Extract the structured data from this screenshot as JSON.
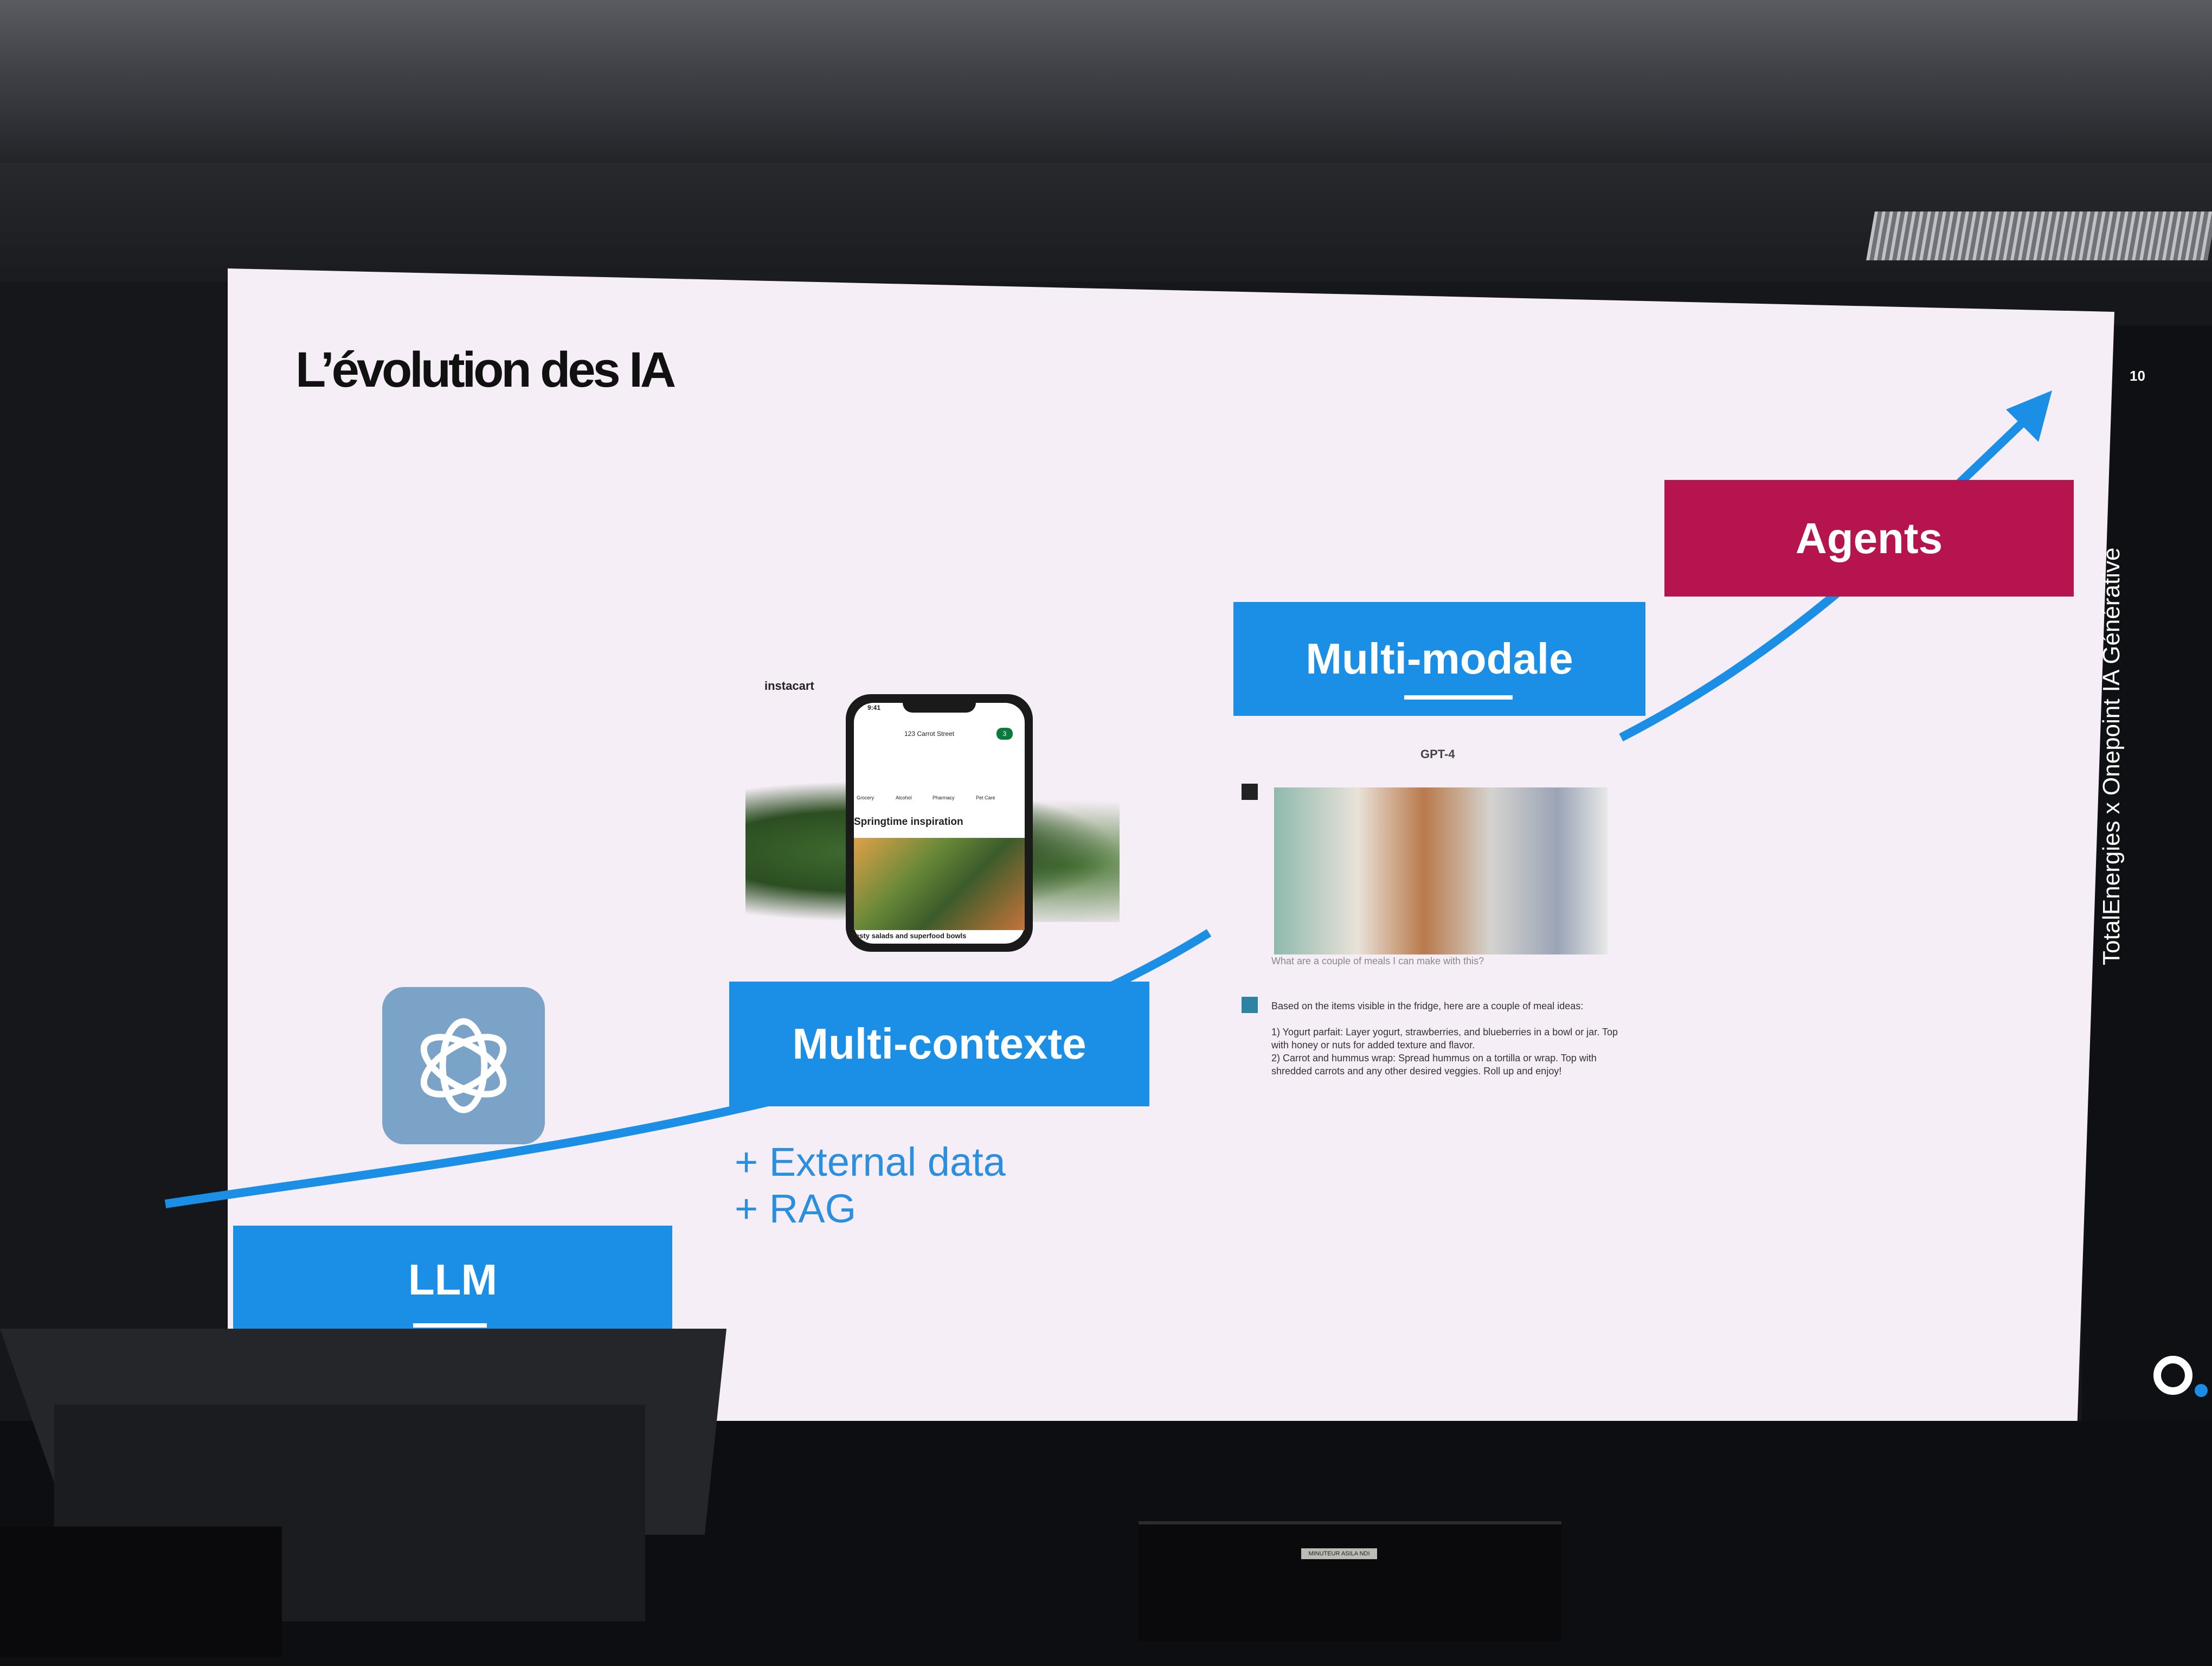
{
  "slide": {
    "title": "L’évolution des IA",
    "page_number": "10",
    "sidebar_text": "TotalEnergies x Onepoint  IA Générative",
    "stages": {
      "llm": "LLM",
      "multi_contexte": "Multi-contexte",
      "multi_modale": "Multi-modale",
      "agents": "Agents"
    },
    "multi_contexte_extras": [
      "+ External data",
      "+ RAG"
    ],
    "colors": {
      "blue": "#1b8fe6",
      "agents": "#b6144f",
      "background": "#f6eef6"
    }
  },
  "instacart": {
    "brand": "instacart",
    "time": "9:41",
    "address": "123 Carrot Street",
    "cart_count": "3",
    "categories": [
      "Grocery",
      "Alcohol",
      "Pharmacy",
      "Pet Care"
    ],
    "heading": "Springtime inspiration",
    "caption": "Zesty salads and superfood bowls"
  },
  "gpt4": {
    "label": "GPT-4",
    "question": "What are a couple of meals I can make with this?",
    "answer_intro": "Based on the items visible in the fridge, here are a couple of meal ideas:",
    "answer_1": "1) Yogurt parfait: Layer yogurt, strawberries, and blueberries in a bowl or jar. Top with honey or nuts for added texture and flavor.",
    "answer_2": "2) Carrot and hummus wrap: Spread hummus on a tortilla or wrap. Top with shredded carrots and any other desired veggies. Roll up and enjoy!"
  },
  "stage_equipment": {
    "speaker_label": "MINUTEUR ASILA NDI"
  }
}
